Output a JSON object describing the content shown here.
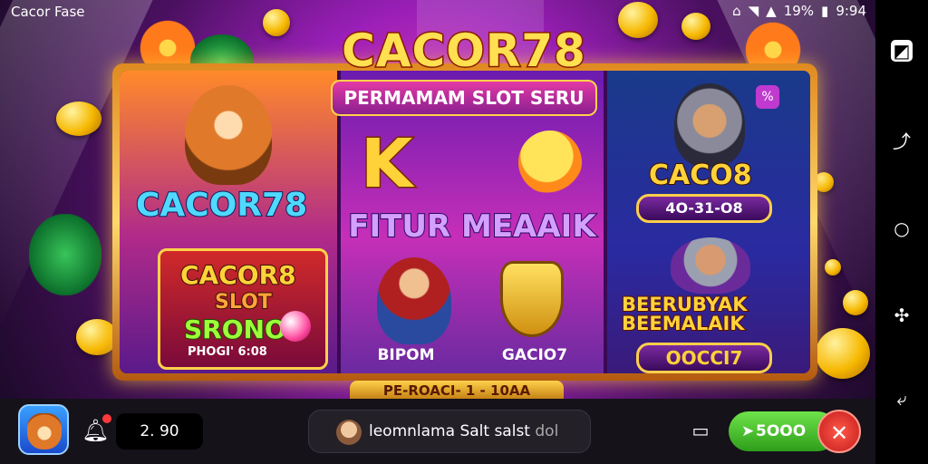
{
  "statusbar": {
    "app_name": "Cacor Fase",
    "battery": "19%",
    "time": "9:94"
  },
  "banner": {
    "title": "CACOR78",
    "subtitle": "PERMAMAM SLOT SERU"
  },
  "left_panel": {
    "logo": "CACOR78",
    "card_line1": "CACOR8",
    "card_line2": "SLOT",
    "card_line3": "SRONO",
    "card_footer": "PHOGI' 6:08"
  },
  "middle_panel": {
    "letter": "K",
    "feature_title": "FITUR MEAAIK",
    "left_caption": "BIPOM",
    "right_caption": "GACIO7"
  },
  "right_panel": {
    "logo": "CACO8",
    "badge_top": "4O-31-O8",
    "headline": "BEERUBYAK BEEMALAIK",
    "badge_bottom": "OOCCI7"
  },
  "bottom_plaque": "PE-ROACI- 1 - 10AA",
  "bottombar": {
    "balance": "2. 90",
    "search_text": "leomnlama Salt salst",
    "search_suffix": "dol",
    "play_label": "5OOO",
    "close_label": "✕"
  },
  "icons": {
    "app": "fox-app-icon",
    "bell": "bell-icon",
    "screen": "screen-icon",
    "play": "arrow-icon",
    "close": "close-icon"
  },
  "colors": {
    "accent_gold": "#ffd23a",
    "accent_pink": "#e33aa5",
    "play_green": "#4fcc2a",
    "close_red": "#e02a2a"
  }
}
